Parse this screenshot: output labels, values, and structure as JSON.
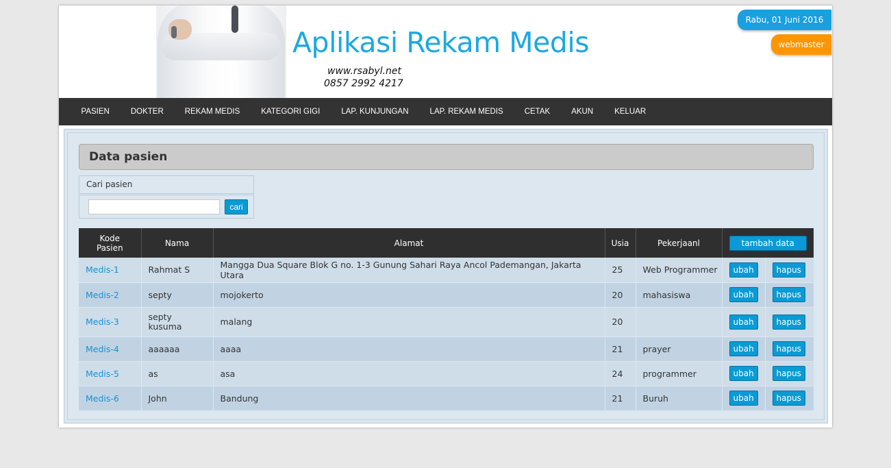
{
  "header": {
    "title": "Aplikasi Rekam Medis",
    "website": "www.rsabyl.net",
    "phone": "0857 2992 4217",
    "date": "Rabu, 01 Juni 2016",
    "user": "webmaster",
    "title_color": "#1da8e0",
    "date_pill_color": "#1a9fe0",
    "user_pill_color": "#ff9500"
  },
  "nav": {
    "items": [
      "PASIEN",
      "DOKTER",
      "REKAM MEDIS",
      "KATEGORI GIGI",
      "LAP. KUNJUNGAN",
      "LAP. REKAM MEDIS",
      "CETAK",
      "AKUN",
      "KELUAR"
    ]
  },
  "page": {
    "heading": "Data pasien"
  },
  "search": {
    "label": "Cari pasien",
    "value": "",
    "button": "cari"
  },
  "table": {
    "headers": {
      "kode": "Kode Pasien",
      "nama": "Nama",
      "alamat": "Alamat",
      "usia": "Usia",
      "pekerjaan": "Pekerjaanl",
      "add_button": "tambah data"
    },
    "edit_label": "ubah",
    "delete_label": "hapus",
    "rows": [
      {
        "kode": "Medis-1",
        "nama": "Rahmat S",
        "alamat": "Mangga Dua Square Blok G no. 1-3 Gunung Sahari Raya Ancol Pademangan, Jakarta Utara",
        "usia": "25",
        "pekerjaan": "Web Programmer"
      },
      {
        "kode": "Medis-2",
        "nama": "septy",
        "alamat": "mojokerto",
        "usia": "20",
        "pekerjaan": "mahasiswa"
      },
      {
        "kode": "Medis-3",
        "nama": "septy kusuma",
        "alamat": "malang",
        "usia": "20",
        "pekerjaan": ""
      },
      {
        "kode": "Medis-4",
        "nama": "aaaaaa",
        "alamat": "aaaa",
        "usia": "21",
        "pekerjaan": "prayer"
      },
      {
        "kode": "Medis-5",
        "nama": "as",
        "alamat": "asa",
        "usia": "24",
        "pekerjaan": "programmer"
      },
      {
        "kode": "Medis-6",
        "nama": "John",
        "alamat": "Bandung",
        "usia": "21",
        "pekerjaan": "Buruh"
      }
    ]
  }
}
